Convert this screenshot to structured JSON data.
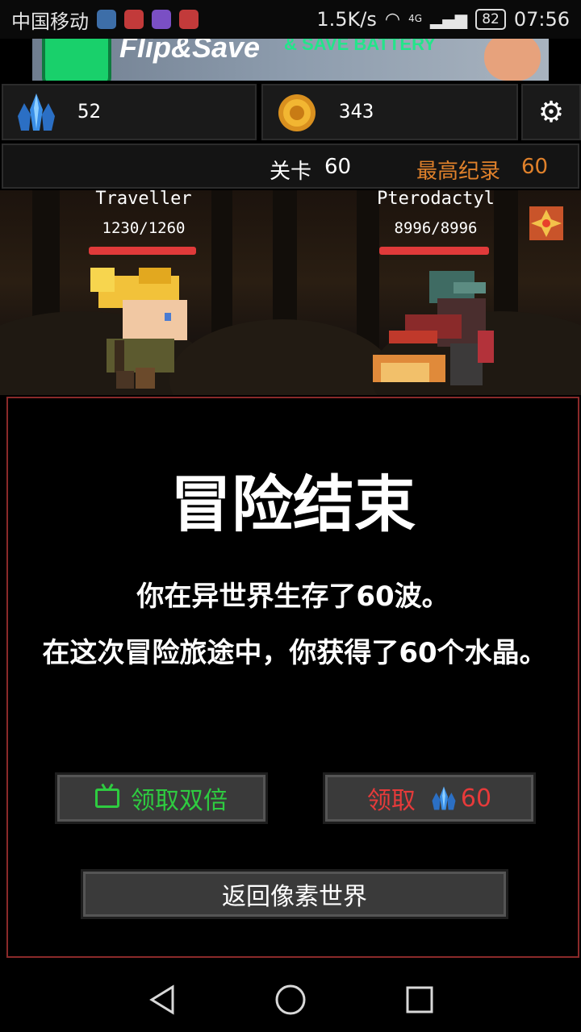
{
  "status_bar": {
    "carrier": "中国移动",
    "net_speed": "1.5K/s",
    "network_type": "4G",
    "battery": "82",
    "time": "07:56"
  },
  "ad": {
    "title": "Flip&Save",
    "subtitle": "& SAVE BATTERY"
  },
  "resources": {
    "crystals": "52",
    "gold": "343"
  },
  "level": {
    "label": "关卡",
    "value": "60",
    "best_label": "最高纪录",
    "best_value": "60"
  },
  "battle": {
    "player": {
      "name": "Traveller",
      "hp": "1230/1260",
      "hp_fraction": 0.976
    },
    "enemy": {
      "name": "Pterodactyl",
      "hp": "8996/8996",
      "hp_fraction": 1.0
    }
  },
  "dialog": {
    "title": "冒险结束",
    "line1": "你在异世界生存了60波。",
    "line2": "在这次冒险旅途中，你获得了60个水晶。",
    "double_button": "领取双倍",
    "claim_button": "领取",
    "claim_amount": "60",
    "return_button": "返回像素世界"
  },
  "colors": {
    "accent_orange": "#e0812b",
    "green": "#2ecc40",
    "red": "#e63a3a",
    "hp_bar": "#e03a3a",
    "dialog_border": "#8a2a2a"
  }
}
